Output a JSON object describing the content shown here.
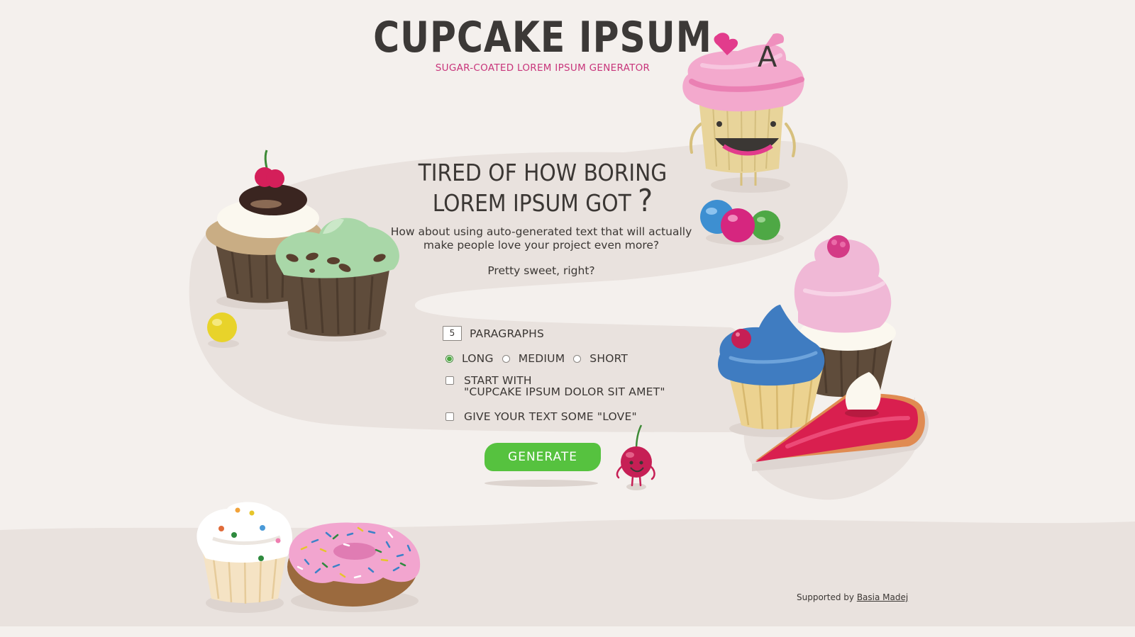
{
  "header": {
    "title": "CUPCAKE IPSUM",
    "subtitle": "SUGAR-COATED LOREM IPSUM GENERATOR"
  },
  "intro": {
    "headline_line1": "TIRED OF HOW BORING",
    "headline_line2": "LOREM IPSUM GOT",
    "question_mark": "?",
    "lead_text": "How about using auto-generated text that will actually make people love your project even more?",
    "tagline": "Pretty sweet, right?"
  },
  "form": {
    "paragraph_count": "5",
    "paragraphs_label": "PARAGRAPHS",
    "length_options": [
      {
        "label": "LONG",
        "checked": true
      },
      {
        "label": "MEDIUM",
        "checked": false
      },
      {
        "label": "SHORT",
        "checked": false
      }
    ],
    "start_with_line1": "START WITH",
    "start_with_line2": "\"CUPCAKE IPSUM DOLOR SIT AMET\"",
    "love_label": "GIVE YOUR TEXT SOME \"LOVE\"",
    "generate_label": "GENERATE"
  },
  "footer": {
    "supported_by": "Supported by",
    "author_link": "Basia Madej"
  },
  "mascot": {
    "hat_letter": "A"
  },
  "colors": {
    "background": "#f4f0ed",
    "path": "#e9e2de",
    "accent_pink": "#c8357b",
    "button_green": "#56c23f"
  }
}
